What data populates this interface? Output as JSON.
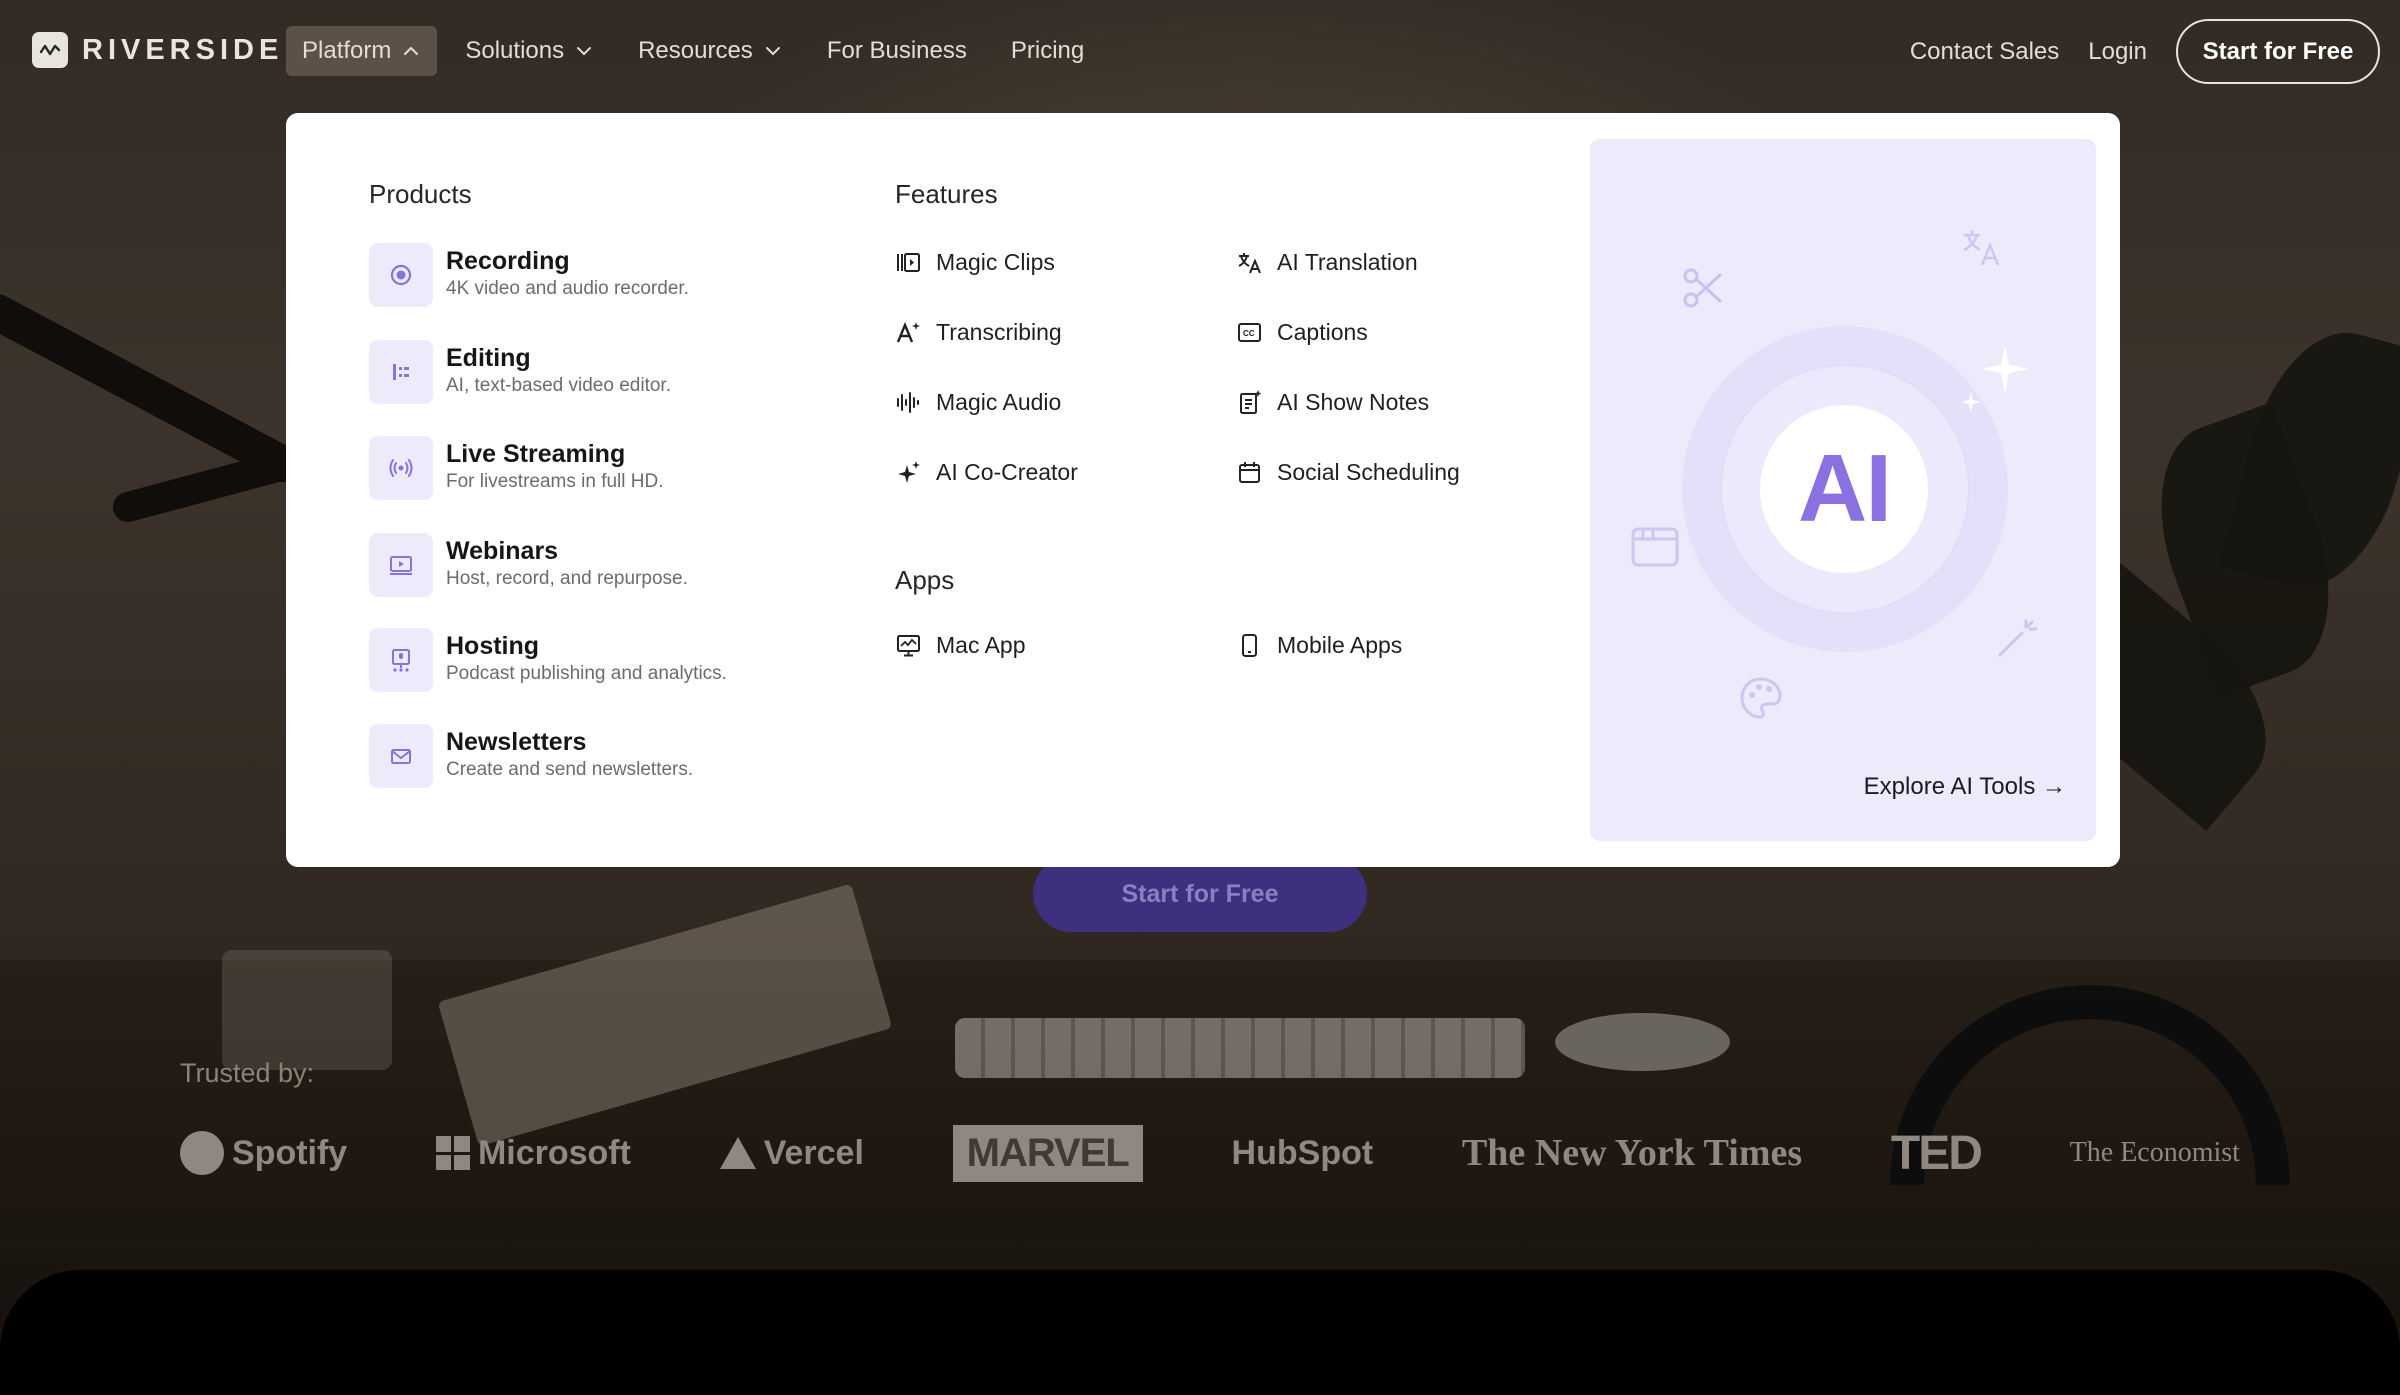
{
  "brand": {
    "name": "RIVERSIDE"
  },
  "nav": {
    "items": [
      {
        "label": "Platform",
        "active": true,
        "has_chevron": true,
        "chevron": "chevron-up-icon"
      },
      {
        "label": "Solutions",
        "has_chevron": true,
        "chevron": "chevron-down-icon"
      },
      {
        "label": "Resources",
        "has_chevron": true,
        "chevron": "chevron-down-icon"
      },
      {
        "label": "For Business"
      },
      {
        "label": "Pricing"
      }
    ],
    "contact": "Contact Sales",
    "login": "Login",
    "cta": "Start for Free"
  },
  "menu": {
    "products_title": "Products",
    "products": [
      {
        "name": "Recording",
        "desc": "4K video and audio recorder.",
        "icon": "record-icon"
      },
      {
        "name": "Editing",
        "desc": "AI, text-based video editor.",
        "icon": "editing-icon"
      },
      {
        "name": "Live Streaming",
        "desc": "For livestreams in full HD.",
        "icon": "broadcast-icon"
      },
      {
        "name": "Webinars",
        "desc": "Host, record, and repurpose.",
        "icon": "screen-play-icon"
      },
      {
        "name": "Hosting",
        "desc": "Podcast publishing and analytics.",
        "icon": "podcast-hosting-icon"
      },
      {
        "name": "Newsletters",
        "desc": "Create and send newsletters.",
        "icon": "envelope-icon"
      }
    ],
    "features_title": "Features",
    "features": [
      {
        "label": "Magic Clips",
        "icon": "clips-icon"
      },
      {
        "label": "AI Translation",
        "icon": "translate-icon"
      },
      {
        "label": "Transcribing",
        "icon": "text-sparkle-icon"
      },
      {
        "label": "Captions",
        "icon": "captions-icon"
      },
      {
        "label": "Magic Audio",
        "icon": "waveform-icon"
      },
      {
        "label": "AI Show Notes",
        "icon": "notes-icon"
      },
      {
        "label": "AI Co-Creator",
        "icon": "sparkles-icon"
      },
      {
        "label": "Social Scheduling",
        "icon": "calendar-icon"
      }
    ],
    "apps_title": "Apps",
    "apps": [
      {
        "label": "Mac App",
        "icon": "desktop-icon"
      },
      {
        "label": "Mobile Apps",
        "icon": "phone-icon"
      }
    ],
    "ai_card": {
      "badge": "AI",
      "link": "Explore AI Tools →"
    }
  },
  "hero": {
    "cta": "Start for Free",
    "trusted_label": "Trusted by:",
    "logos": [
      "Spotify",
      "Microsoft",
      "Vercel",
      "MARVEL",
      "HubSpot",
      "The New York Times",
      "TED",
      "The Economist"
    ]
  },
  "colors": {
    "accent": "#8a70e0",
    "icon_tile": "#ecebfb",
    "ai_card_bg": "#ecebfc",
    "panel_bg": "#ffffff"
  }
}
